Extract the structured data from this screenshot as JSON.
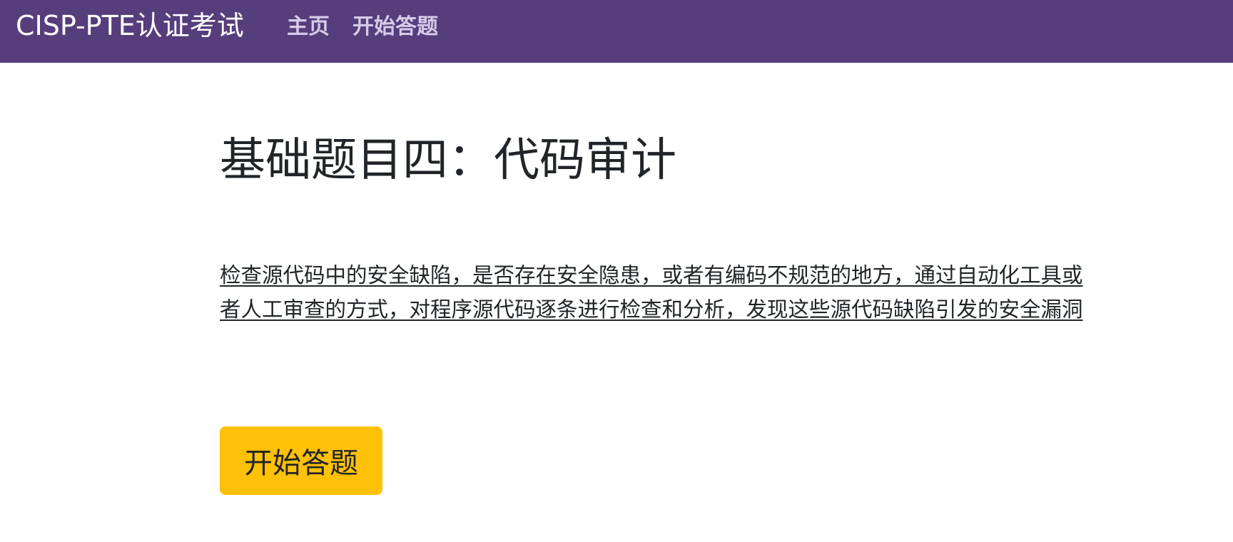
{
  "navbar": {
    "brand": "CISP-PTE认证考试",
    "links": [
      {
        "label": "主页"
      },
      {
        "label": "开始答题"
      }
    ]
  },
  "main": {
    "title": "基础题目四：代码审计",
    "description": "检查源代码中的安全缺陷，是否存在安全隐患，或者有编码不规范的地方，通过自动化工具或者人工审查的方式，对程序源代码逐条进行检查和分析，发现这些源代码缺陷引发的安全漏洞",
    "start_button": "开始答题"
  },
  "colors": {
    "navbar_bg": "#563d7c",
    "nav_link": "#d6cbe8",
    "button_bg": "#ffc107",
    "text": "#212529"
  }
}
